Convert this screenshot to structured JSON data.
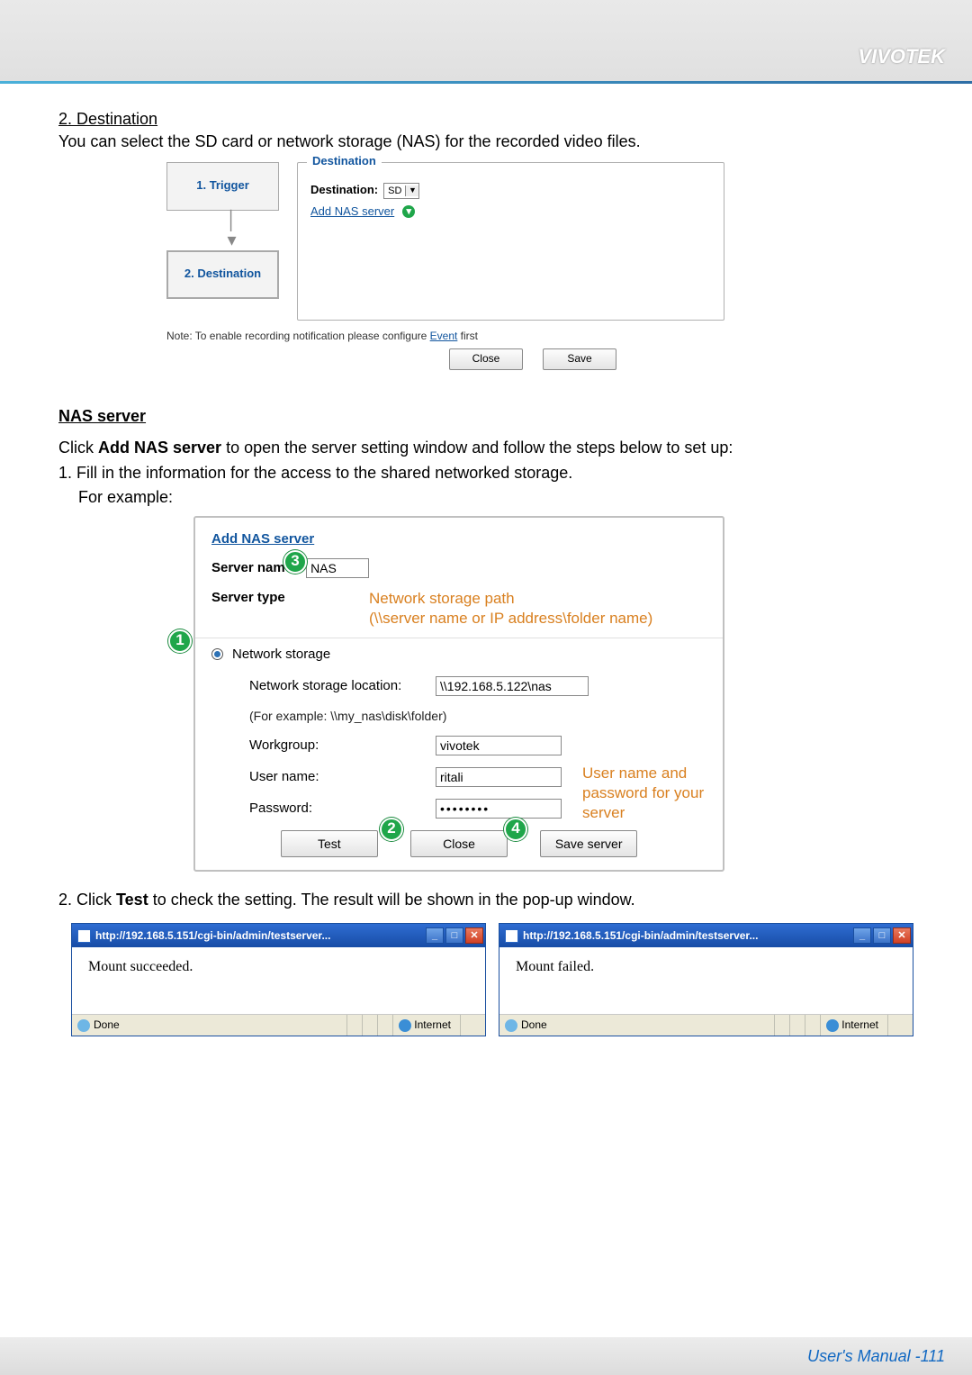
{
  "brand": "VIVOTEK",
  "section": {
    "title": "2. Destination",
    "intro": "You can select the SD card or network storage (NAS) for the recorded video files."
  },
  "dest_shot": {
    "step1": "1.  Trigger",
    "step2": "2.  Destination",
    "legend": "Destination",
    "dest_label": "Destination:",
    "dest_value": "SD",
    "add_link": "Add NAS server",
    "note_prefix": "Note: To enable recording notification please configure ",
    "note_link": "Event",
    "note_suffix": " first",
    "btn_close": "Close",
    "btn_save": "Save"
  },
  "nas": {
    "heading": "NAS server",
    "para_pre": "Click ",
    "para_bold": "Add NAS server",
    "para_post": " to open the server setting window and follow the steps below to set up:",
    "step1": "1. Fill in the information for the access to the shared networked storage.",
    "step1b": "For example:",
    "step2_pre": "2. Click ",
    "step2_bold": "Test",
    "step2_post": " to check the setting. The result will be shown in the pop-up window."
  },
  "nas_panel": {
    "add_link": "Add NAS server",
    "server_name_label": "Server name:",
    "server_name_value": "NAS",
    "server_type_label": "Server type",
    "orange1": "Network storage path",
    "orange2": "(\\\\server name or IP address\\folder name)",
    "radio_label": "Network storage",
    "loc_label": "Network storage location:",
    "loc_value": "\\\\192.168.5.122\\nas",
    "loc_hint": "(For example: \\\\my_nas\\disk\\folder)",
    "wg_label": "Workgroup:",
    "wg_value": "vivotek",
    "user_label": "User name:",
    "user_value": "ritali",
    "pw_label": "Password:",
    "pw_value": "••••••••",
    "orange_cred1": "User name and",
    "orange_cred2": "password for your",
    "orange_cred3": "server",
    "btn_test": "Test",
    "btn_close": "Close",
    "btn_save": "Save server",
    "badge1": "1",
    "badge2": "2",
    "badge3": "3",
    "badge4": "4"
  },
  "popup": {
    "title": "http://192.168.5.151/cgi-bin/admin/testserver...",
    "body_ok": "Mount succeeded.",
    "body_fail": "Mount failed.",
    "status_done": "Done",
    "status_zone": "Internet"
  },
  "footer": {
    "text": "User's Manual - ",
    "page": "111"
  }
}
